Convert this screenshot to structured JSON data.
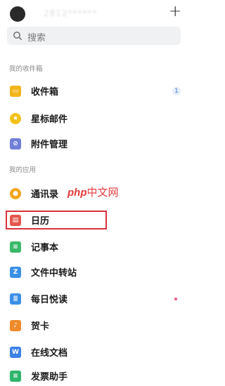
{
  "header": {
    "account": "2812******",
    "add_label": "+"
  },
  "search": {
    "placeholder": "搜索"
  },
  "sections": {
    "inbox_title": "我的收件箱",
    "apps_title": "我的应用"
  },
  "inbox_items": [
    {
      "label": "收件箱",
      "icon": "inbox-icon",
      "color": "#f2b51b",
      "badge": "1"
    },
    {
      "label": "星标邮件",
      "icon": "star-icon",
      "color": "#f2c21b"
    },
    {
      "label": "附件管理",
      "icon": "attachment-icon",
      "color": "#6f7fd8"
    }
  ],
  "app_items": [
    {
      "label": "通讯录",
      "icon": "contacts-icon",
      "color": "#f2a51b"
    },
    {
      "label": "日历",
      "icon": "calendar-icon",
      "color": "#e4574e"
    },
    {
      "label": "记事本",
      "icon": "notepad-icon",
      "color": "#3cb86a"
    },
    {
      "label": "文件中转站",
      "icon": "file-transfer-icon",
      "color": "#3c8fe6"
    },
    {
      "label": "每日悦读",
      "icon": "daily-reading-icon",
      "color": "#3c8fe6"
    },
    {
      "label": "贺卡",
      "icon": "greeting-card-icon",
      "color": "#f08a2a"
    },
    {
      "label": "在线文档",
      "icon": "online-doc-icon",
      "color": "#3c7fe6"
    },
    {
      "label": "发票助手",
      "icon": "invoice-icon",
      "color": "#2fb56b"
    }
  ],
  "watermark": {
    "php": "php",
    "cn": "中文网"
  }
}
